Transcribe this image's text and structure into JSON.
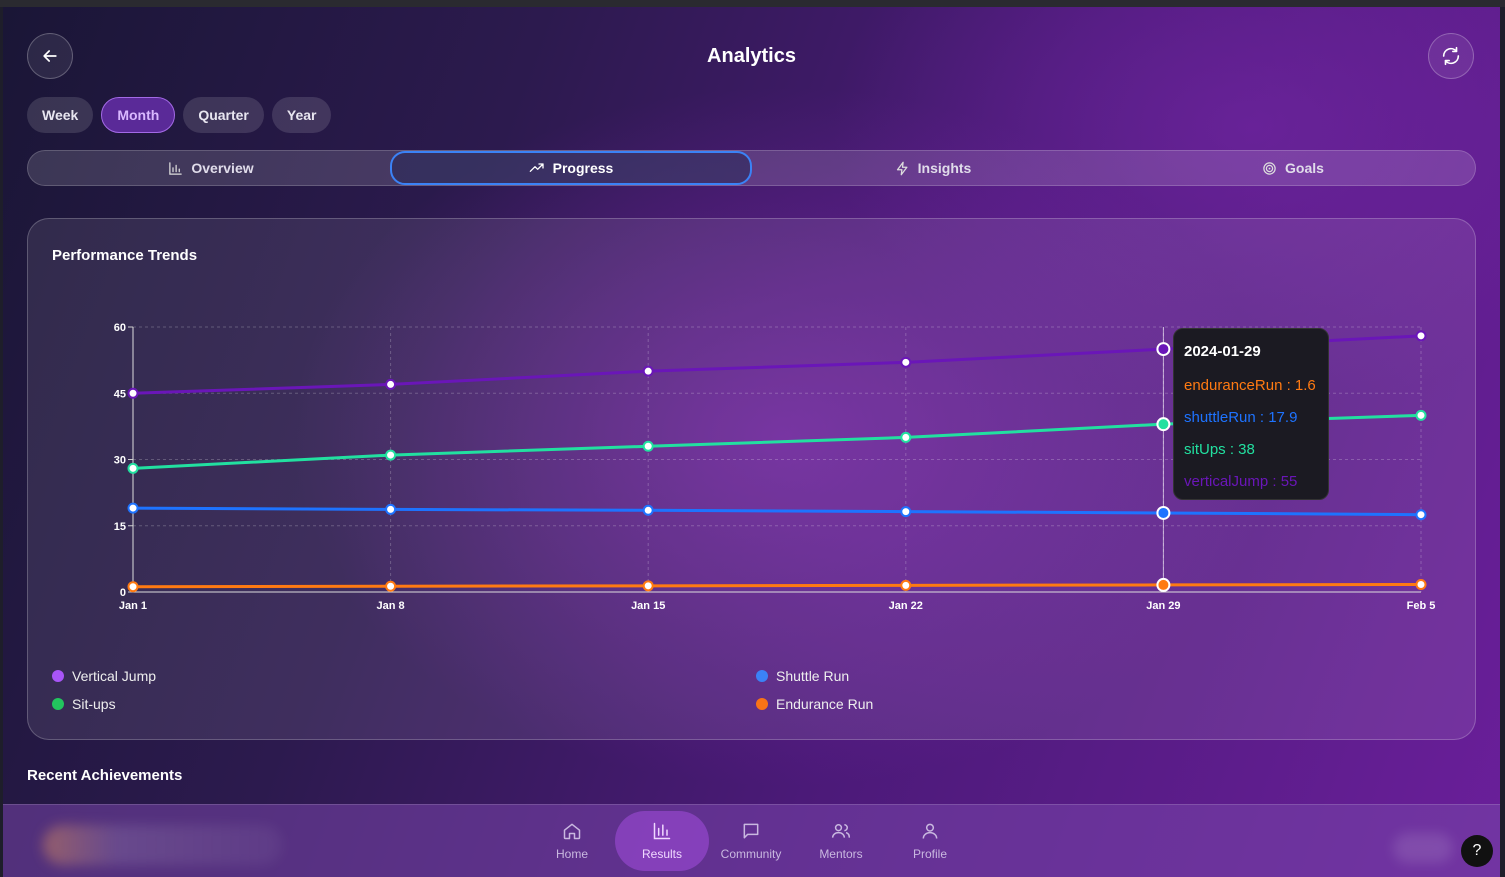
{
  "header": {
    "title": "Analytics"
  },
  "periods": [
    {
      "label": "Week",
      "active": false
    },
    {
      "label": "Month",
      "active": true
    },
    {
      "label": "Quarter",
      "active": false
    },
    {
      "label": "Year",
      "active": false
    }
  ],
  "tabs": [
    {
      "label": "Overview",
      "icon": "bar-chart-icon",
      "active": false
    },
    {
      "label": "Progress",
      "icon": "trending-up-icon",
      "active": true
    },
    {
      "label": "Insights",
      "icon": "lightning-icon",
      "active": false
    },
    {
      "label": "Goals",
      "icon": "target-icon",
      "active": false
    }
  ],
  "card": {
    "title": "Performance Trends"
  },
  "colors": {
    "verticalJump": "#6a16b8",
    "situps": "#22e0a0",
    "shuttleRun": "#1e73ff",
    "enduranceRun": "#ff7a12"
  },
  "chart_data": {
    "type": "line",
    "categories": [
      "Jan 1",
      "Jan 8",
      "Jan 15",
      "Jan 22",
      "Jan 29",
      "Feb 5"
    ],
    "ylim": [
      0,
      60
    ],
    "yticks": [
      0,
      15,
      30,
      45,
      60
    ],
    "grid": true,
    "legend_position": "bottom",
    "series": [
      {
        "key": "verticalJump",
        "name": "Vertical Jump",
        "values": [
          45,
          47,
          50,
          52,
          55,
          58
        ]
      },
      {
        "key": "situps",
        "name": "Sit-ups",
        "values": [
          28,
          31,
          33,
          35,
          38,
          40
        ]
      },
      {
        "key": "shuttleRun",
        "name": "Shuttle Run",
        "values": [
          19,
          18.7,
          18.5,
          18.2,
          17.9,
          17.5
        ]
      },
      {
        "key": "enduranceRun",
        "name": "Endurance Run",
        "values": [
          1.2,
          1.3,
          1.4,
          1.5,
          1.6,
          1.7
        ]
      }
    ]
  },
  "tooltip": {
    "date": "2024-01-29",
    "rows": [
      {
        "text": "enduranceRun : 1.6",
        "color": "#ff7a12"
      },
      {
        "text": "shuttleRun : 17.9",
        "color": "#1e73ff"
      },
      {
        "text": "sitUps : 38",
        "color": "#22e0a0"
      },
      {
        "text": "verticalJump : 55",
        "color": "#6a16b8"
      }
    ]
  },
  "sections": {
    "recent_achievements": "Recent Achievements"
  },
  "nav": [
    {
      "label": "Home",
      "icon": "home-icon",
      "active": false
    },
    {
      "label": "Results",
      "icon": "bar-chart-icon",
      "active": true
    },
    {
      "label": "Community",
      "icon": "chat-icon",
      "active": false
    },
    {
      "label": "Mentors",
      "icon": "users-icon",
      "active": false
    },
    {
      "label": "Profile",
      "icon": "user-icon",
      "active": false
    }
  ],
  "help": "?"
}
